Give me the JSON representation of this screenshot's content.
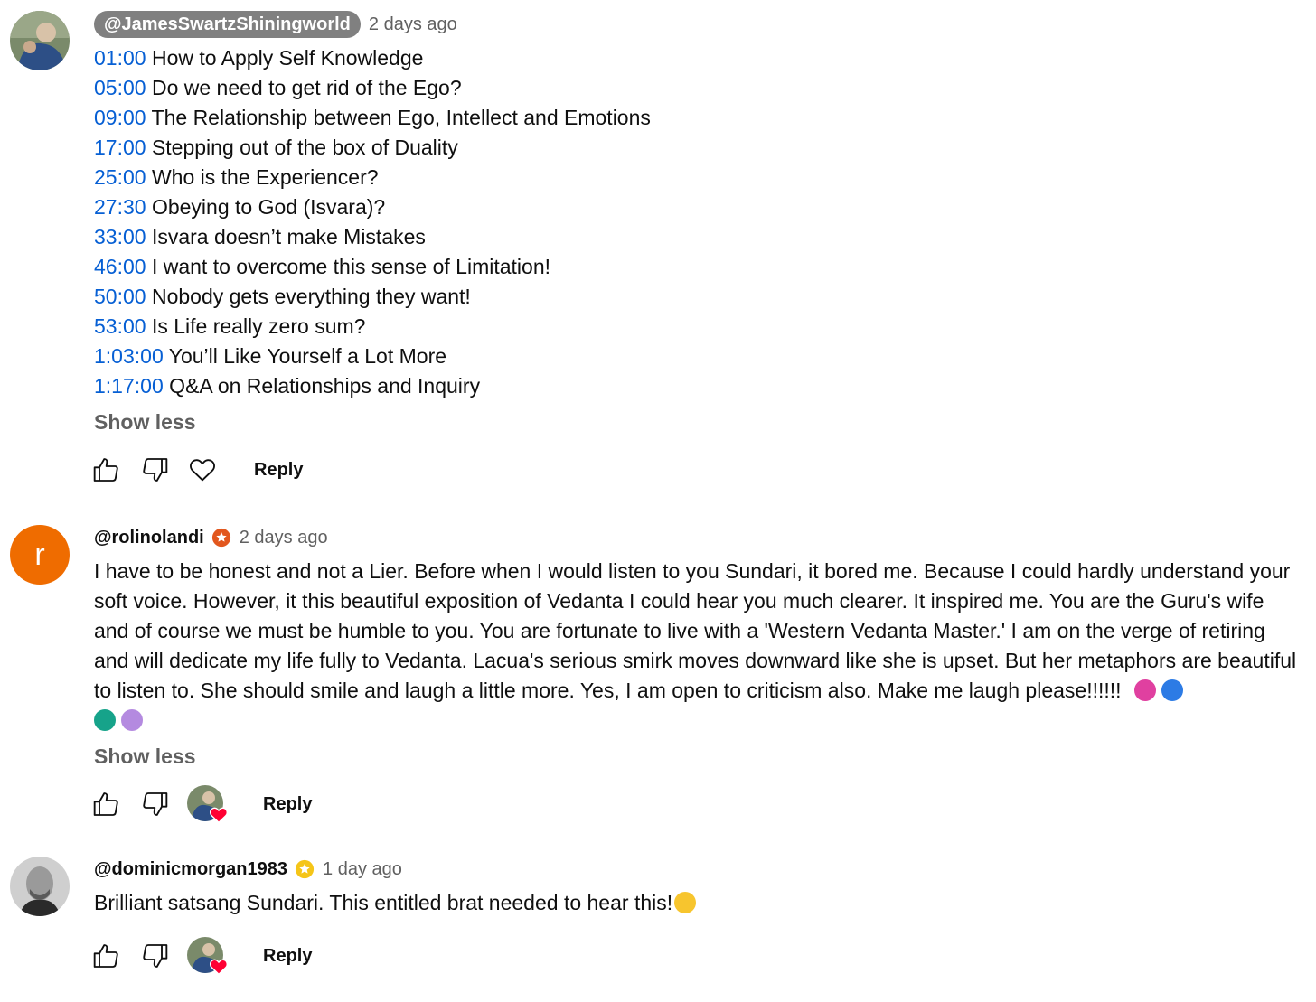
{
  "comments": [
    {
      "author": "@JamesSwartzShiningworld",
      "time": "2 days ago",
      "chapters": [
        {
          "ts": "01:00",
          "title": "How to Apply Self Knowledge"
        },
        {
          "ts": "05:00",
          "title": "Do we need to get rid of the Ego?"
        },
        {
          "ts": "09:00",
          "title": "The Relationship between Ego, Intellect and Emotions"
        },
        {
          "ts": "17:00",
          "title": "Stepping out of the box of Duality"
        },
        {
          "ts": "25:00",
          "title": "Who is the Experiencer?"
        },
        {
          "ts": "27:30",
          "title": "Obeying to God (Isvara)?"
        },
        {
          "ts": "33:00",
          "title": "Isvara doesn’t make Mistakes"
        },
        {
          "ts": "46:00",
          "title": "I want to overcome this sense of Limitation!"
        },
        {
          "ts": "50:00",
          "title": "Nobody gets everything they want!"
        },
        {
          "ts": "53:00",
          "title": "Is Life really zero sum?"
        },
        {
          "ts": "1:03:00",
          "title": "You’ll Like Yourself a Lot More"
        },
        {
          "ts": "1:17:00",
          "title": "Q&A on Relationships and Inquiry"
        }
      ],
      "show_less": "Show less",
      "reply": "Reply"
    },
    {
      "author": "@rolinolandi",
      "avatar_letter": "r",
      "badge_color": "#e2571e",
      "time": "2 days ago",
      "text": "I have to be honest and not a Lier.  Before when I would listen to you Sundari, it bored me.  Because I could hardly understand your soft voice.  However, it this beautiful exposition of Vedanta I could hear you much clearer.  It inspired me.  You are the Guru's wife and of course we must be humble to you.  You are fortunate to live with a 'Western Vedanta Master.'  I am on the verge of retiring and will dedicate my life fully to Vedanta.  Lacua's serious smirk moves downward like she is upset.  But her metaphors are beautiful to listen to.  She should smile and laugh a little more.  Yes, I am open to criticism also.  Make me laugh please!!!!!!",
      "emojis": [
        "pile-of-poo-emoji",
        "blue-spirit-emoji",
        "family-emoji",
        "ghost-emoji"
      ],
      "show_less": "Show less",
      "reply": "Reply"
    },
    {
      "author": "@dominicmorgan1983",
      "badge_color": "#f5c518",
      "time": "1 day ago",
      "text": "Brilliant satsang Sundari. This entitled brat needed to hear this!",
      "emoji": "laughing-tears-emoji",
      "reply": "Reply"
    }
  ],
  "colors": {
    "link": "#065fd4",
    "secondary": "#606060",
    "chip": "#808080",
    "heart": "#ff0033"
  }
}
